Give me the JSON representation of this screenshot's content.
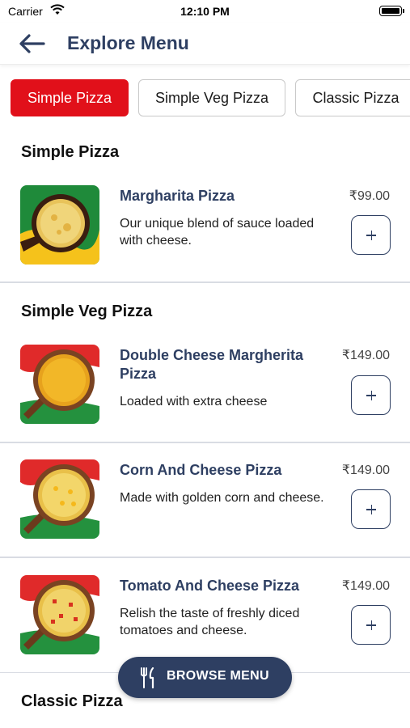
{
  "status_bar": {
    "carrier": "Carrier",
    "time": "12:10 PM"
  },
  "header": {
    "title": "Explore Menu"
  },
  "tabs": [
    {
      "label": "Simple Pizza",
      "active": true
    },
    {
      "label": "Simple Veg Pizza",
      "active": false
    },
    {
      "label": "Classic Pizza",
      "active": false
    }
  ],
  "sections": [
    {
      "title": "Simple Pizza",
      "items": [
        {
          "name": "Margharita Pizza",
          "price": "₹99.00",
          "description": "Our unique blend of sauce loaded with cheese."
        }
      ]
    },
    {
      "title": "Simple Veg Pizza",
      "items": [
        {
          "name": "Double Cheese Margherita Pizza",
          "price": "₹149.00",
          "description": "Loaded with extra cheese"
        },
        {
          "name": "Corn And Cheese Pizza",
          "price": "₹149.00",
          "description": "Made with golden corn and cheese."
        },
        {
          "name": "Tomato And Cheese Pizza",
          "price": "₹149.00",
          "description": "Relish the taste of freshly diced tomatoes and cheese."
        }
      ]
    },
    {
      "title": "Classic Pizza",
      "items": []
    }
  ],
  "browse_button": {
    "label": "BROWSE MENU",
    "icon": "fork-knife-icon"
  },
  "colors": {
    "brand_navy": "#2e3f62",
    "accent_red": "#e1101a"
  }
}
